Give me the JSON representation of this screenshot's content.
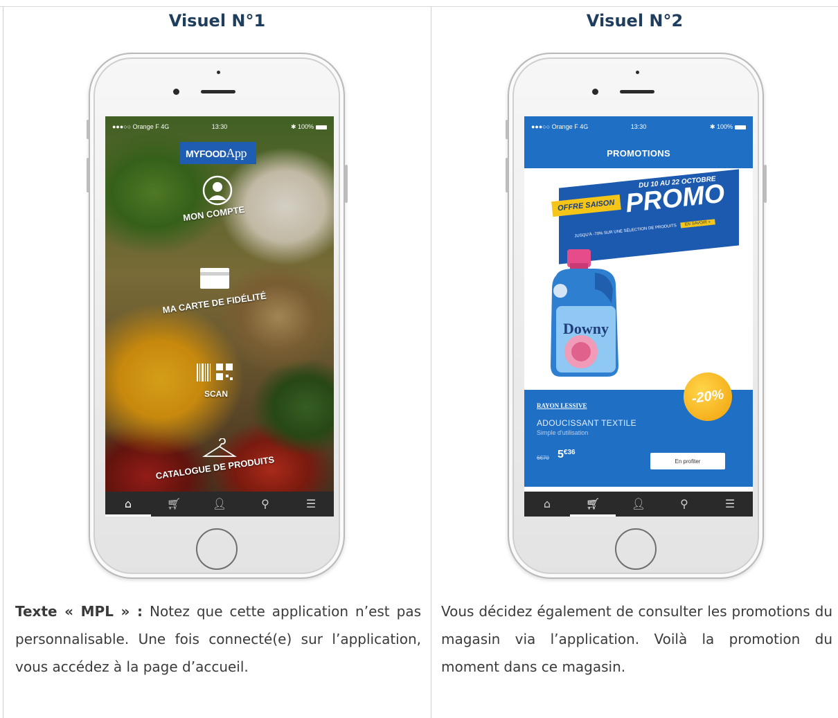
{
  "columns": [
    {
      "title": "Visuel N°1",
      "screen": {
        "status_left": "●●●○○ Orange F  4G",
        "status_time": "13:30",
        "status_right": "✱ 100%",
        "logo_main": "MYFOOD",
        "logo_app": "App",
        "menu_items": [
          {
            "label": "MON COMPTE",
            "icon": "user-circle-icon"
          },
          {
            "label": "MA CARTE DE FIDÉLITÉ",
            "icon": "card-icon"
          },
          {
            "label": "SCAN",
            "icon": "barcode-qr-icon"
          },
          {
            "label": "CATALOGUE DE PRODUITS",
            "icon": "hanger-icon"
          }
        ],
        "tabs": [
          "home-icon",
          "cart-icon",
          "user-icon",
          "location-pin-icon",
          "menu-icon"
        ],
        "active_tab": 0
      },
      "text_bold": "Texte « MPL » :",
      "text": " Notez que cette application n’est pas personnalisable. Une fois connecté(e) sur l’application, vous accédez à la page d’accueil."
    },
    {
      "title": "Visuel N°2",
      "screen": {
        "status_left": "●●●○○ Orange F  4G",
        "status_time": "13:30",
        "status_right": "✱ 100%",
        "header_title": "PROMOTIONS",
        "banner_dates": "DU 10 AU 22 OCTOBRE",
        "banner_offre": "OFFRE SAISON",
        "banner_promo": "PROMO",
        "banner_sub": "JUSQU'À -70% SUR UNE SÉLECTION DE PRODUITS",
        "banner_tag": "EN SAVOIR +",
        "product_brand": "Downy",
        "discount": "-20%",
        "rayon": "RAYON LESSIVE",
        "product_name": "ADOUCISSANT TEXTILE",
        "product_desc": "Simple d'utilisation",
        "old_price": "6€70",
        "new_price_main": "5",
        "new_price_sup": "€36",
        "profit_button": "En profiter",
        "tabs": [
          "home-icon",
          "cart-icon",
          "user-icon",
          "location-pin-icon",
          "menu-icon"
        ],
        "active_tab": 1
      },
      "text": "Vous décidez également de consulter les promotions du magasin via l’application. Voilà la promotion du moment dans ce magasin."
    }
  ]
}
